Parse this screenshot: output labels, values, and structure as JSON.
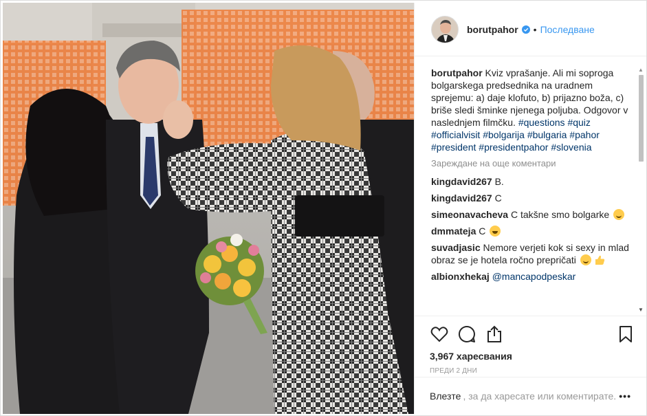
{
  "post": {
    "username": "borutpahor",
    "follow_label": "Последване",
    "dot": "•",
    "caption_user": "borutpahor",
    "caption_text": "Kviz vprašanje. Ali mi soproga bolgarskega predsednika na uradnem sprejemu: a) daje klofuto, b) prijazno boža, c) briše sledi šminke njenega poljuba. Odgovor v naslednjem filmčku.",
    "hashtags": [
      "#questions",
      "#quiz",
      "#officialvisit",
      "#bolgarija",
      "#bulgaria",
      "#pahor",
      "#president",
      "#presidentpahor",
      "#slovenia"
    ],
    "load_more": "Зареждане на още коментари",
    "comments": [
      {
        "user": "kingdavid267",
        "text": "B."
      },
      {
        "user": "kingdavid267",
        "text": "C"
      },
      {
        "user": "simeonavacheva",
        "text": "C takšne smo bolgarke"
      },
      {
        "user": "dmmateja",
        "text": "C"
      },
      {
        "user": "suvadjasic",
        "text": "Nemore verjeti kok si sexy in mlad obraz se je hotela ročno prepričati"
      },
      {
        "user": "albionxhekaj",
        "text": "@mancapodpeskar"
      }
    ],
    "likes": "3,967 харесвания",
    "time": "ПРЕДИ 2 ДНИ",
    "login_link": "Влезте",
    "login_text": ", за да харесате или коментирате.",
    "more": "•••"
  },
  "icons": [
    "verified-icon",
    "heart-icon",
    "comment-icon",
    "share-icon",
    "bookmark-icon",
    "more-options-icon"
  ],
  "colors": {
    "link": "#3897f0",
    "hashtag": "#003569",
    "muted": "#8e8e8e",
    "text": "#262626"
  }
}
